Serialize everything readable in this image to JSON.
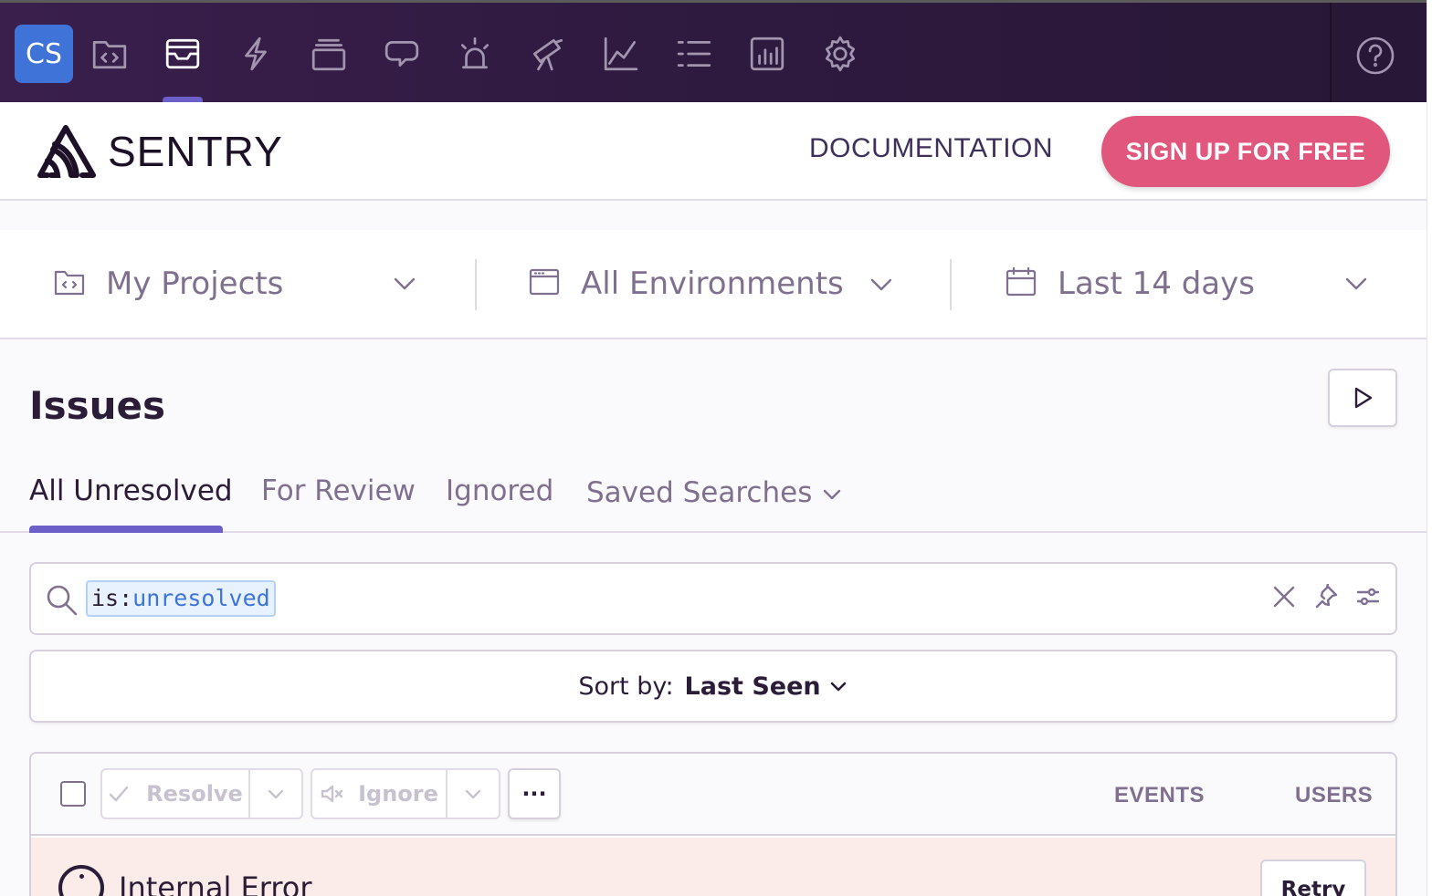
{
  "topnav": {
    "org_initials": "CS",
    "icons": [
      "projects-icon",
      "issues-icon",
      "performance-icon",
      "releases-icon",
      "user-feedback-icon",
      "alerts-icon",
      "discover-icon",
      "dashboards-icon",
      "activity-icon",
      "stats-icon",
      "settings-icon"
    ],
    "active_icon": "issues-icon",
    "help_icon": "help-icon"
  },
  "header": {
    "logo_text": "SENTRY",
    "documentation_label": "DOCUMENTATION",
    "signup_label": "SIGN UP FOR FREE",
    "signup_color": "#e1567c"
  },
  "filters": {
    "projects": "My Projects",
    "environments": "All Environments",
    "date_range": "Last 14 days"
  },
  "page": {
    "title": "Issues"
  },
  "tabs": [
    {
      "label": "All Unresolved",
      "active": true
    },
    {
      "label": "For Review",
      "active": false
    },
    {
      "label": "Ignored",
      "active": false
    },
    {
      "label": "Saved Searches",
      "active": false
    }
  ],
  "search": {
    "token_key": "is:",
    "token_value": "unresolved"
  },
  "sort": {
    "label": "Sort by:",
    "value": "Last Seen"
  },
  "issue_list": {
    "resolve_label": "Resolve",
    "ignore_label": "Ignore",
    "more_label": "···",
    "columns": [
      "EVENTS",
      "USERS"
    ],
    "error_message": "Internal Error",
    "retry_label": "Retry"
  },
  "colors": {
    "accent": "#6c5fc7",
    "nav_bg": "#2f1a40",
    "org_badge": "#3f73d8",
    "error_bg": "#fcece9"
  }
}
